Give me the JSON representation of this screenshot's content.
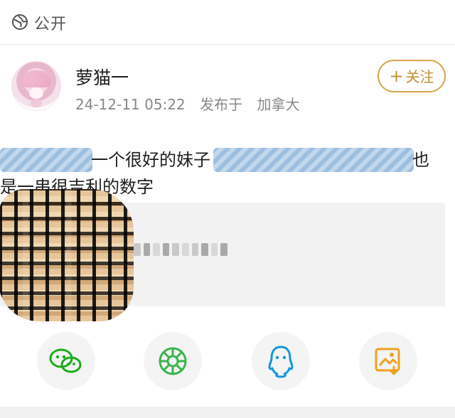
{
  "top_bar": {
    "visibility_label": "公开",
    "icon": "globe-icon"
  },
  "post": {
    "author": "萝猫一",
    "timestamp": "24-12-11 05:22",
    "location_prefix": "发布于",
    "location": "加拿大",
    "follow_button": "关注",
    "follow_icon": "plus-icon",
    "line1_segment1": "一个很好的妹子",
    "line1_segment2": "也",
    "line2": "是一串很吉利的数字"
  },
  "share": {
    "items": [
      {
        "icon": "wechat-icon",
        "color": "#1aad19"
      },
      {
        "icon": "moments-icon",
        "color": "#39b54a"
      },
      {
        "icon": "qq-icon",
        "color": "#1296db"
      },
      {
        "icon": "save-image-icon",
        "color": "#f0a020"
      }
    ]
  },
  "colors": {
    "follow_accent": "#c58d30",
    "redaction": "#9fc2e6"
  }
}
